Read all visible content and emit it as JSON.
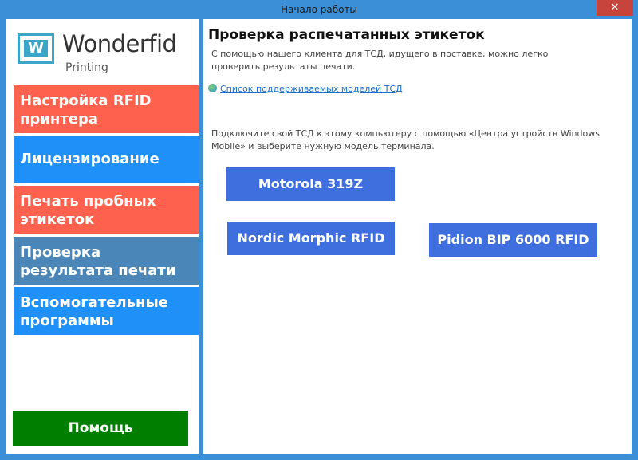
{
  "window": {
    "title": "Начало работы",
    "close_glyph": "✕"
  },
  "logo": {
    "mark": "W",
    "name": "Wonderfid",
    "subtitle": "Printing"
  },
  "sidebar": {
    "items": [
      {
        "label": "Настройка RFID принтера",
        "color": "#fe614d"
      },
      {
        "label": "Лицензирование",
        "color": "#1e90f8"
      },
      {
        "label": "Печать пробных этикеток",
        "color": "#fe614d"
      },
      {
        "label": "Проверка результата печати",
        "color": "#4a86b8",
        "selected": true
      },
      {
        "label": "Вспомогательные программы",
        "color": "#1e90f8"
      }
    ],
    "help_label": "Помощь",
    "help_color": "#007e00"
  },
  "main": {
    "title": "Проверка распечатанных этикеток",
    "intro": "С помощью нашего клиента для ТСД, идущего в поставке, можно легко проверить результаты печати.",
    "link_label": "Список поддерживаемых моделей ТСД",
    "instruction": "Подключите свой ТСД к этому компьютеру с помощью «Центра устройств Windows Mobile» и выберите нужную модель терминала.",
    "devices": [
      {
        "label": "Motorola 319Z"
      },
      {
        "label": "Nordic Morphic RFID"
      },
      {
        "label": "Pidion BIP 6000 RFID"
      }
    ],
    "button_color": "#3f6edf"
  }
}
